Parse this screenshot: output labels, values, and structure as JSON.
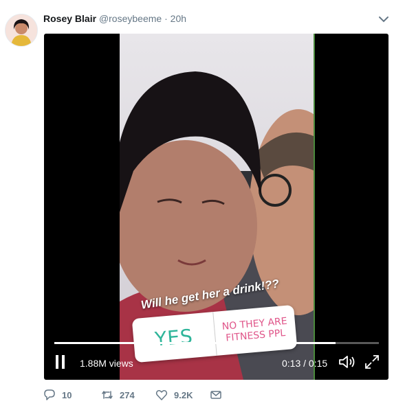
{
  "tweet": {
    "author_name": "Rosey Blair",
    "handle": "@roseybeeme",
    "separator": "·",
    "time": "20h"
  },
  "video": {
    "caption": "Will he get her a drink!??",
    "poll": {
      "option_yes": "YES",
      "option_no": "NO THEY ARE FITNESS PPL"
    },
    "views": "1.88M views",
    "timecode": "0:13 / 0:15",
    "progress_fraction": 0.866
  },
  "actions": {
    "replies": "10",
    "retweets": "274",
    "likes": "9.2K"
  },
  "colors": {
    "poll_yes": "#2fb59a",
    "poll_no": "#e0568a",
    "secondary_text": "#657786"
  },
  "icons": [
    "chevron-down-icon",
    "pause-icon",
    "volume-icon",
    "fullscreen-icon",
    "reply-icon",
    "retweet-icon",
    "like-icon",
    "direct-message-icon"
  ]
}
